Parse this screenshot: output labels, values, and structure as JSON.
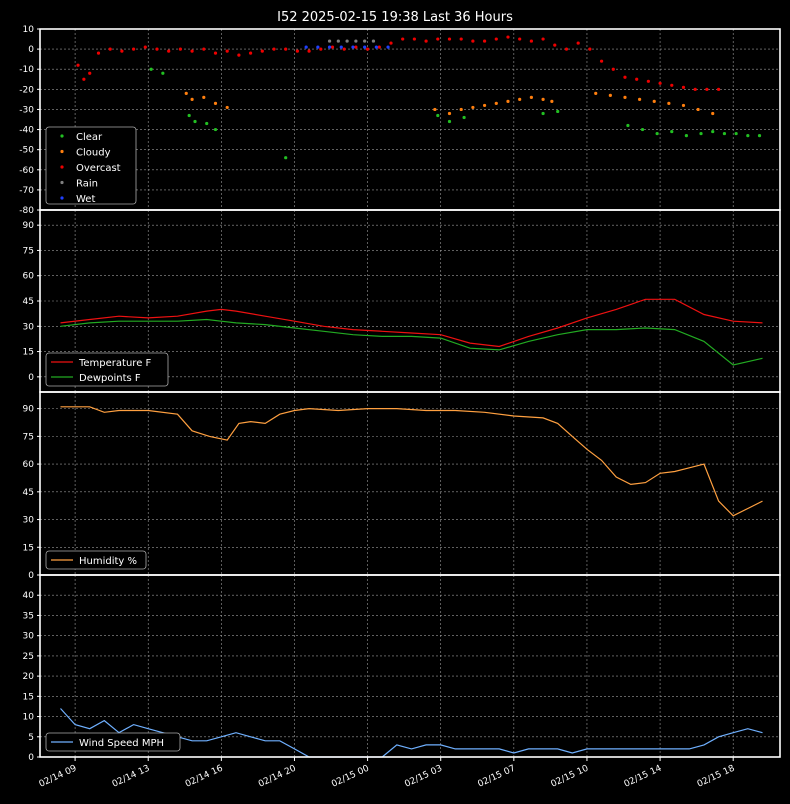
{
  "title": "I52 2025-02-15 19:38 Last 36 Hours",
  "x_tick_labels": [
    "02/14 09",
    "02/14 13",
    "02/14 16",
    "02/14 20",
    "02/15 00",
    "02/15 03",
    "02/15 07",
    "02/15 10",
    "02/15 14",
    "02/15 18"
  ],
  "colors": {
    "background": "#000000",
    "grid": "#9a9a9a",
    "frame": "#ffffff",
    "clear": "#22c022",
    "cloudy": "#ff7f0e",
    "overcast": "#ee0000",
    "rain": "#7f7f7f",
    "wet": "#1f3fff",
    "temperature": "#ee1111",
    "dewpoint": "#22aa22",
    "humidity": "#ffa040",
    "wind": "#6fb0ff"
  },
  "chart_data": [
    {
      "type": "scatter",
      "ylim": [
        -80,
        10
      ],
      "yticks": [
        10,
        0,
        -10,
        -20,
        -30,
        -40,
        -50,
        -60,
        -70,
        -80
      ],
      "legend": "lower-left",
      "grid": true,
      "series": [
        {
          "name": "Clear",
          "color_key": "clear",
          "points": [
            [
              2.6,
              -10
            ],
            [
              3.0,
              -12
            ],
            [
              3.9,
              -33
            ],
            [
              4.1,
              -36
            ],
            [
              4.5,
              -37
            ],
            [
              4.8,
              -40
            ],
            [
              7.2,
              -54
            ],
            [
              12.4,
              -33
            ],
            [
              12.8,
              -36
            ],
            [
              13.3,
              -34
            ],
            [
              16.0,
              -32
            ],
            [
              16.5,
              -31
            ],
            [
              18.9,
              -38
            ],
            [
              19.4,
              -40
            ],
            [
              19.9,
              -42
            ],
            [
              20.4,
              -41
            ],
            [
              20.9,
              -43
            ],
            [
              21.4,
              -42
            ],
            [
              21.8,
              -41
            ],
            [
              22.2,
              -42
            ],
            [
              22.6,
              -42
            ],
            [
              23.0,
              -43
            ],
            [
              23.4,
              -43
            ]
          ]
        },
        {
          "name": "Cloudy",
          "color_key": "cloudy",
          "points": [
            [
              3.8,
              -22
            ],
            [
              4.0,
              -25
            ],
            [
              4.4,
              -24
            ],
            [
              4.8,
              -27
            ],
            [
              5.2,
              -29
            ],
            [
              12.3,
              -30
            ],
            [
              12.8,
              -32
            ],
            [
              13.2,
              -30
            ],
            [
              13.6,
              -29
            ],
            [
              14.0,
              -28
            ],
            [
              14.4,
              -27
            ],
            [
              14.8,
              -26
            ],
            [
              15.2,
              -25
            ],
            [
              15.6,
              -24
            ],
            [
              16.0,
              -25
            ],
            [
              16.3,
              -26
            ],
            [
              17.8,
              -22
            ],
            [
              18.3,
              -23
            ],
            [
              18.8,
              -24
            ],
            [
              19.3,
              -25
            ],
            [
              19.8,
              -26
            ],
            [
              20.3,
              -27
            ],
            [
              20.8,
              -28
            ],
            [
              21.3,
              -30
            ],
            [
              21.8,
              -32
            ]
          ]
        },
        {
          "name": "Overcast",
          "color_key": "overcast",
          "points": [
            [
              0.1,
              -8
            ],
            [
              0.3,
              -15
            ],
            [
              0.5,
              -12
            ],
            [
              0.8,
              -2
            ],
            [
              1.2,
              0
            ],
            [
              1.6,
              -1
            ],
            [
              2.0,
              0
            ],
            [
              2.4,
              1
            ],
            [
              2.8,
              0
            ],
            [
              3.2,
              -1
            ],
            [
              3.6,
              0
            ],
            [
              4.0,
              -1
            ],
            [
              4.4,
              0
            ],
            [
              4.8,
              -2
            ],
            [
              5.2,
              -1
            ],
            [
              5.6,
              -3
            ],
            [
              6.0,
              -2
            ],
            [
              6.4,
              -1
            ],
            [
              6.8,
              0
            ],
            [
              7.2,
              0
            ],
            [
              7.6,
              -1
            ],
            [
              8.0,
              -1
            ],
            [
              8.4,
              0
            ],
            [
              8.8,
              1
            ],
            [
              9.2,
              0
            ],
            [
              9.6,
              1
            ],
            [
              10.0,
              0
            ],
            [
              10.4,
              1
            ],
            [
              10.8,
              3
            ],
            [
              11.2,
              5
            ],
            [
              11.6,
              5
            ],
            [
              12.0,
              4
            ],
            [
              12.4,
              5
            ],
            [
              12.8,
              5
            ],
            [
              13.2,
              5
            ],
            [
              13.6,
              4
            ],
            [
              14.0,
              4
            ],
            [
              14.4,
              5
            ],
            [
              14.8,
              6
            ],
            [
              15.2,
              5
            ],
            [
              15.6,
              4
            ],
            [
              16.0,
              5
            ],
            [
              16.4,
              2
            ],
            [
              16.8,
              0
            ],
            [
              17.2,
              3
            ],
            [
              17.6,
              0
            ],
            [
              18.0,
              -6
            ],
            [
              18.4,
              -10
            ],
            [
              18.8,
              -14
            ],
            [
              19.2,
              -15
            ],
            [
              19.6,
              -16
            ],
            [
              20.0,
              -17
            ],
            [
              20.4,
              -18
            ],
            [
              20.8,
              -19
            ],
            [
              21.2,
              -20
            ],
            [
              21.6,
              -20
            ],
            [
              22.0,
              -20
            ]
          ]
        },
        {
          "name": "Rain",
          "color_key": "rain",
          "points": [
            [
              8.7,
              4
            ],
            [
              9.0,
              4
            ],
            [
              9.3,
              4
            ],
            [
              9.6,
              4
            ],
            [
              9.9,
              4
            ],
            [
              10.2,
              4
            ]
          ]
        },
        {
          "name": "Wet",
          "color_key": "wet",
          "points": [
            [
              7.9,
              1
            ],
            [
              8.3,
              1
            ],
            [
              8.7,
              1
            ],
            [
              9.1,
              1
            ],
            [
              9.5,
              1
            ],
            [
              9.9,
              1
            ],
            [
              10.3,
              1
            ],
            [
              10.7,
              1
            ]
          ]
        }
      ]
    },
    {
      "type": "line",
      "ylim": [
        -9,
        99
      ],
      "yticks": [
        90,
        75,
        60,
        45,
        30,
        15,
        0
      ],
      "legend": "lower-left",
      "grid": true,
      "series": [
        {
          "name": "Temperature F",
          "color_key": "temperature",
          "x": [
            -0.5,
            0.5,
            1.5,
            2.5,
            3.5,
            4.5,
            5.0,
            5.5,
            6.5,
            7.5,
            8.5,
            9.5,
            10.5,
            11.5,
            12.5,
            13.5,
            14.5,
            15.5,
            16.5,
            17.5,
            18.5,
            19.5,
            20.5,
            21.5,
            22.5,
            23.5
          ],
          "y": [
            32,
            34,
            36,
            35,
            36,
            39,
            40,
            39,
            36,
            33,
            30,
            28,
            27,
            26,
            25,
            20,
            18,
            24,
            29,
            35,
            40,
            46,
            46,
            37,
            33,
            32
          ]
        },
        {
          "name": "Dewpoints F",
          "color_key": "dewpoint",
          "x": [
            -0.5,
            0.5,
            1.5,
            2.5,
            3.5,
            4.5,
            5.0,
            5.5,
            6.5,
            7.5,
            8.5,
            9.5,
            10.5,
            11.5,
            12.5,
            13.5,
            14.5,
            15.5,
            16.5,
            17.5,
            18.5,
            19.5,
            20.5,
            21.5,
            22.5,
            23.5
          ],
          "y": [
            30,
            32,
            33,
            33,
            33,
            34,
            33,
            32,
            31,
            29,
            27,
            25,
            24,
            24,
            23,
            17,
            16,
            21,
            25,
            28,
            28,
            29,
            28,
            21,
            7,
            11
          ]
        }
      ]
    },
    {
      "type": "line",
      "ylim": [
        0,
        99
      ],
      "yticks": [
        90,
        75,
        60,
        45,
        30,
        15,
        0
      ],
      "legend": "lower-left",
      "grid": true,
      "series": [
        {
          "name": "Humidity %",
          "color_key": "humidity",
          "x": [
            -0.5,
            0.5,
            1.0,
            1.5,
            2.5,
            3.5,
            4.0,
            4.6,
            5.2,
            5.6,
            6.0,
            6.5,
            7.0,
            7.5,
            8.0,
            9.0,
            10.0,
            11.0,
            12.0,
            13.0,
            14.0,
            15.0,
            16.0,
            16.5,
            17.0,
            17.5,
            18.0,
            18.5,
            19.0,
            19.5,
            20.0,
            20.5,
            21.0,
            21.5,
            22.0,
            22.5,
            23.0,
            23.5
          ],
          "y": [
            91,
            91,
            88,
            89,
            89,
            87,
            78,
            75,
            73,
            82,
            83,
            82,
            87,
            89,
            90,
            89,
            90,
            90,
            89,
            89,
            88,
            86,
            85,
            82,
            75,
            68,
            62,
            53,
            49,
            50,
            55,
            56,
            58,
            60,
            40,
            32,
            36,
            40
          ]
        }
      ]
    },
    {
      "type": "line",
      "ylim": [
        0,
        45
      ],
      "yticks": [
        40,
        35,
        30,
        25,
        20,
        15,
        10,
        5,
        0
      ],
      "legend": "lower-left",
      "grid": true,
      "series": [
        {
          "name": "Wind Speed MPH",
          "color_key": "wind",
          "x": [
            -0.5,
            0,
            0.5,
            1,
            1.5,
            2,
            2.5,
            3,
            3.5,
            4,
            4.5,
            5,
            5.5,
            6,
            6.5,
            7,
            7.5,
            8,
            8.5,
            9,
            9.5,
            10,
            10.5,
            11,
            11.5,
            12,
            12.5,
            13,
            13.5,
            14,
            14.5,
            15,
            15.5,
            16,
            16.5,
            17,
            17.5,
            18,
            18.5,
            19,
            19.5,
            20,
            20.5,
            21,
            21.5,
            22,
            22.5,
            23,
            23.5
          ],
          "y": [
            12,
            8,
            7,
            9,
            6,
            8,
            7,
            6,
            5,
            4,
            4,
            5,
            6,
            5,
            4,
            4,
            2,
            0,
            0,
            0,
            0,
            0,
            0,
            3,
            2,
            3,
            3,
            2,
            2,
            2,
            2,
            1,
            2,
            2,
            2,
            1,
            2,
            2,
            2,
            2,
            2,
            2,
            2,
            2,
            3,
            5,
            6,
            7,
            6
          ]
        }
      ]
    }
  ]
}
